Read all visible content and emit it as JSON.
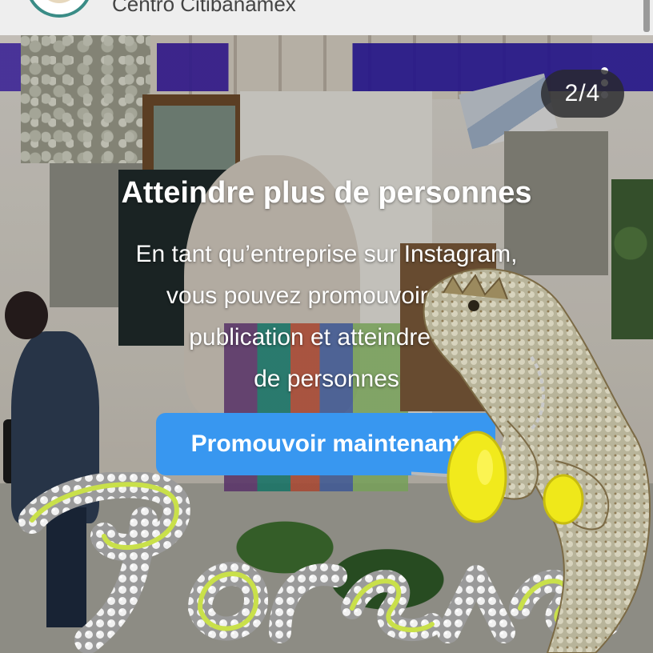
{
  "header": {
    "account_name": "Centro Citibanamex"
  },
  "post": {
    "page_counter": "2/4",
    "more_icon": "more-vertical-icon"
  },
  "promotion": {
    "title": "Atteindre plus de personnes",
    "body_line1": "En tant qu’entreprise sur Instagram,",
    "body_line2": "vous pouvez promouvoir cette",
    "body_line3": "publication et atteindre de",
    "body_line4": "de personnes",
    "button_label": "Promouvoir maintenant"
  },
  "stickers": {
    "glitter_word": "Forever",
    "lizard": "bearded-dragon-lizard-sticker"
  },
  "colors": {
    "button": "#3897f0",
    "counter_pill": "#28282c",
    "header_bg": "#eeeeee",
    "text_overlay": "#ffffff"
  }
}
